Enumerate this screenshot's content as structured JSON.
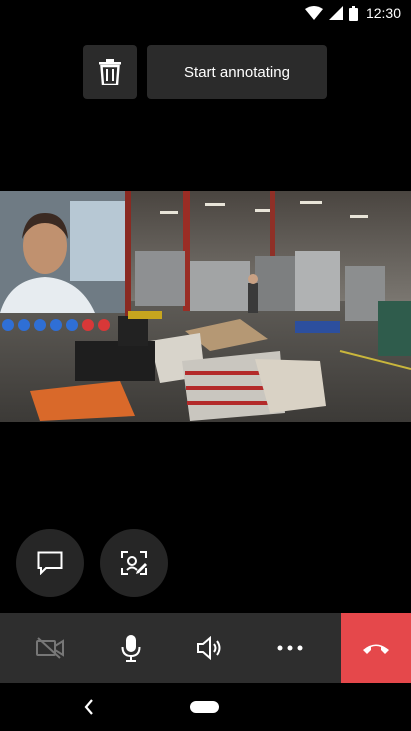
{
  "status_bar": {
    "time": "12:30",
    "icons": [
      "wifi-icon",
      "signal-icon",
      "battery-icon"
    ]
  },
  "toolbar": {
    "delete_icon": "trash-icon",
    "annotate_label": "Start annotating"
  },
  "video": {
    "main": "warehouse-video-feed",
    "pip": "self-view-video"
  },
  "quick_actions": [
    {
      "icon": "chat-icon"
    },
    {
      "icon": "snapshot-annotate-icon"
    }
  ],
  "call_controls": [
    {
      "icon": "camera-off-icon"
    },
    {
      "icon": "microphone-icon"
    },
    {
      "icon": "speaker-icon"
    },
    {
      "icon": "more-options-icon"
    },
    {
      "icon": "hang-up-icon",
      "color": "#e5484b"
    }
  ],
  "nav_bar": {
    "back_icon": "back-icon",
    "home_icon": "home-pill-icon"
  }
}
